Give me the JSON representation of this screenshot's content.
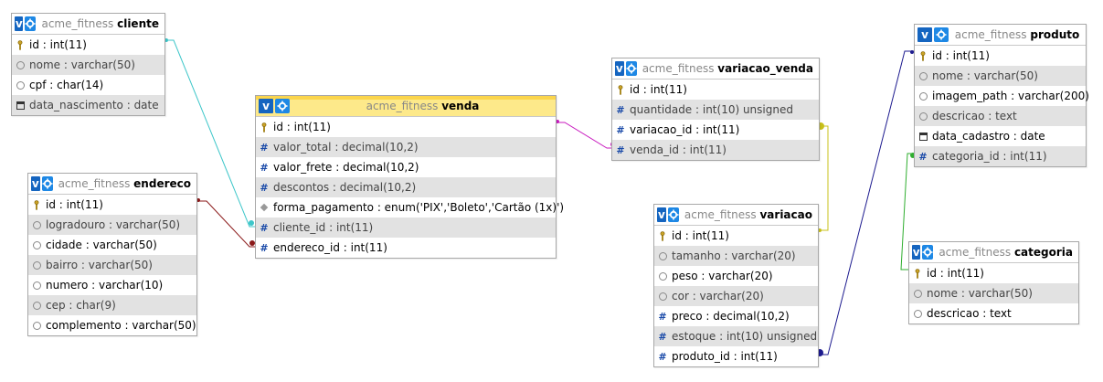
{
  "colors": {
    "venda_cliente": "#3dc6c9",
    "venda_endereco": "#8b1a1a",
    "variacao_venda_venda": "#c81bbf",
    "variacao_venda_variacao": "#c8c01a",
    "variacao_produto": "#1d1b8f",
    "produto_categoria": "#2fae2f"
  },
  "tables": {
    "cliente": {
      "db": "acme_fitness",
      "name": "cliente",
      "columns": [
        {
          "icon": "key-icon",
          "text": "id : int(11)"
        },
        {
          "icon": "text-icon",
          "text": "nome : varchar(50)"
        },
        {
          "icon": "text-icon",
          "text": "cpf : char(14)"
        },
        {
          "icon": "date-icon",
          "text": "data_nascimento : date"
        }
      ]
    },
    "endereco": {
      "db": "acme_fitness",
      "name": "endereco",
      "columns": [
        {
          "icon": "key-icon",
          "text": "id : int(11)"
        },
        {
          "icon": "text-icon",
          "text": "logradouro : varchar(50)"
        },
        {
          "icon": "text-icon",
          "text": "cidade : varchar(50)"
        },
        {
          "icon": "text-icon",
          "text": "bairro : varchar(50)"
        },
        {
          "icon": "text-icon",
          "text": "numero : varchar(10)"
        },
        {
          "icon": "text-icon",
          "text": "cep : char(9)"
        },
        {
          "icon": "text-icon",
          "text": "complemento : varchar(50)"
        }
      ]
    },
    "venda": {
      "db": "acme_fitness",
      "name": "venda",
      "columns": [
        {
          "icon": "key-icon",
          "text": "id : int(11)"
        },
        {
          "icon": "number-icon",
          "text": "valor_total : decimal(10,2)"
        },
        {
          "icon": "number-icon",
          "text": "valor_frete : decimal(10,2)"
        },
        {
          "icon": "number-icon",
          "text": "descontos : decimal(10,2)"
        },
        {
          "icon": "enum-icon",
          "text": "forma_pagamento : enum('PIX','Boleto','Cartão (1x)')"
        },
        {
          "icon": "number-icon",
          "text": "cliente_id : int(11)"
        },
        {
          "icon": "number-icon",
          "text": "endereco_id : int(11)"
        }
      ]
    },
    "variacao_venda": {
      "db": "acme_fitness",
      "name": "variacao_venda",
      "columns": [
        {
          "icon": "key-icon",
          "text": "id : int(11)"
        },
        {
          "icon": "number-icon",
          "text": "quantidade : int(10) unsigned"
        },
        {
          "icon": "number-icon",
          "text": "variacao_id : int(11)"
        },
        {
          "icon": "number-icon",
          "text": "venda_id : int(11)"
        }
      ]
    },
    "variacao": {
      "db": "acme_fitness",
      "name": "variacao",
      "columns": [
        {
          "icon": "key-icon",
          "text": "id : int(11)"
        },
        {
          "icon": "text-icon",
          "text": "tamanho : varchar(20)"
        },
        {
          "icon": "text-icon",
          "text": "peso : varchar(20)"
        },
        {
          "icon": "text-icon",
          "text": "cor : varchar(20)"
        },
        {
          "icon": "number-icon",
          "text": "preco : decimal(10,2)"
        },
        {
          "icon": "number-icon",
          "text": "estoque : int(10) unsigned"
        },
        {
          "icon": "number-icon",
          "text": "produto_id : int(11)"
        }
      ]
    },
    "produto": {
      "db": "acme_fitness",
      "name": "produto",
      "columns": [
        {
          "icon": "key-icon",
          "text": "id : int(11)"
        },
        {
          "icon": "text-icon",
          "text": "nome : varchar(50)"
        },
        {
          "icon": "text-icon",
          "text": "imagem_path : varchar(200)"
        },
        {
          "icon": "text-icon",
          "text": "descricao : text"
        },
        {
          "icon": "date-icon",
          "text": "data_cadastro : date"
        },
        {
          "icon": "number-icon",
          "text": "categoria_id : int(11)"
        }
      ]
    },
    "categoria": {
      "db": "acme_fitness",
      "name": "categoria",
      "columns": [
        {
          "icon": "key-icon",
          "text": "id : int(11)"
        },
        {
          "icon": "text-icon",
          "text": "nome : varchar(50)"
        },
        {
          "icon": "text-icon",
          "text": "descricao : text"
        }
      ]
    }
  }
}
